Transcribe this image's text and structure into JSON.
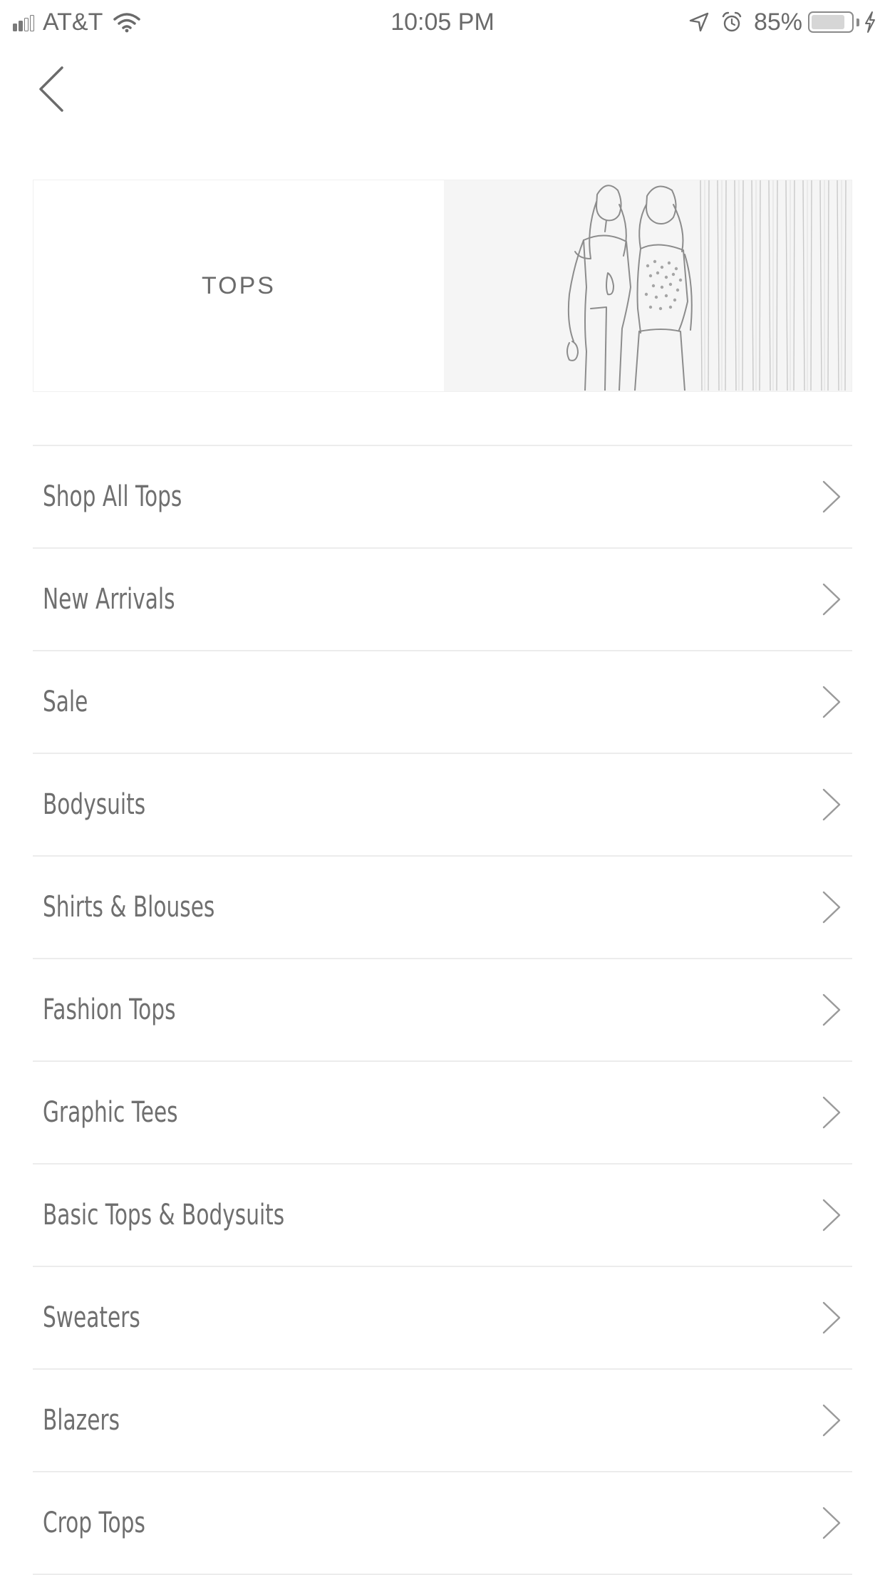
{
  "status_bar": {
    "carrier": "AT&T",
    "time": "10:05 PM",
    "battery_percent": "85%",
    "battery_level": 0.85,
    "signal_bars_filled": 2,
    "signal_bars_total": 4,
    "icons": [
      "signal-icon",
      "wifi-icon",
      "location-arrow-icon",
      "alarm-icon",
      "battery-icon",
      "charging-bolt-icon"
    ]
  },
  "nav": {
    "back_icon": "chevron-left-icon"
  },
  "hero": {
    "title": "TOPS",
    "image": "two-women-photo"
  },
  "categories": [
    "Shop All Tops",
    "New Arrivals",
    "Sale",
    "Bodysuits",
    "Shirts & Blouses",
    "Fashion Tops",
    "Graphic Tees",
    "Basic Tops & Bodysuits",
    "Sweaters",
    "Blazers",
    "Crop Tops"
  ]
}
